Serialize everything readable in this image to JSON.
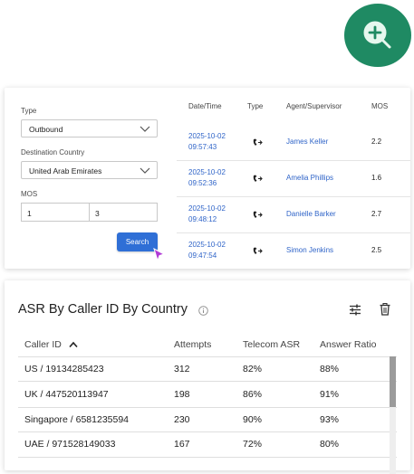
{
  "search_form": {
    "type_label": "Type",
    "type_value": "Outbound",
    "country_label": "Destination Country",
    "country_value": "United Arab Emirates",
    "mos_label": "MOS",
    "mos_min": "1",
    "mos_max": "3",
    "search_button": "Search"
  },
  "calls_table": {
    "headers": [
      "Date/Time",
      "Type",
      "Agent/Supervisor",
      "MOS"
    ],
    "rows": [
      {
        "date": "2025-10-02",
        "time": "09:57:43",
        "type_icon": "outbound-call-icon",
        "agent": "James Keller",
        "mos": "2.2"
      },
      {
        "date": "2025-10-02",
        "time": "09:52:36",
        "type_icon": "outbound-call-icon",
        "agent": "Amelia Phillips",
        "mos": "1.6"
      },
      {
        "date": "2025-10-02",
        "time": "09:48:12",
        "type_icon": "outbound-call-icon",
        "agent": "Danielle Barker",
        "mos": "2.7"
      },
      {
        "date": "2025-10-02",
        "time": "09:47:54",
        "type_icon": "outbound-call-icon",
        "agent": "Simon Jenkins",
        "mos": "2.5"
      }
    ]
  },
  "asr_report": {
    "title": "ASR By Caller ID By Country",
    "headers": [
      "Caller ID",
      "Attempts",
      "Telecom ASR",
      "Answer Ratio"
    ],
    "sort_column": "Caller ID",
    "sort_direction": "ascending",
    "rows": [
      {
        "caller": "US / 19134285423",
        "attempts": "312",
        "asr": "82%",
        "ratio": "88%"
      },
      {
        "caller": "UK / 447520113947",
        "attempts": "198",
        "asr": "86%",
        "ratio": "91%"
      },
      {
        "caller": "Singapore / 6581235594",
        "attempts": "230",
        "asr": "90%",
        "ratio": "93%"
      },
      {
        "caller": "UAE / 971528149033",
        "attempts": "167",
        "asr": "72%",
        "ratio": "80%"
      }
    ]
  },
  "colors": {
    "fab": "#1f8a63",
    "link": "#2f64c8",
    "button": "#2f6fd6",
    "cursor": "#b13bd6"
  }
}
